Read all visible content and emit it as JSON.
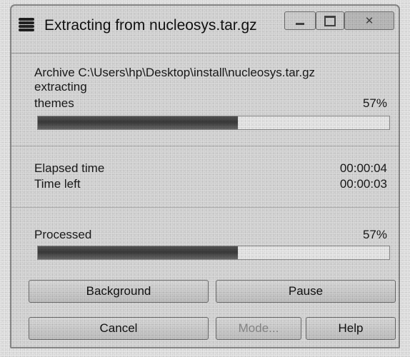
{
  "window": {
    "title": "Extracting from nucleosys.tar.gz",
    "controls": [
      "minimize",
      "maximize",
      "close"
    ]
  },
  "archive": {
    "path_line": "Archive C:\\Users\\hp\\Desktop\\install\\nucleosys.tar.gz",
    "status": "extracting",
    "current_item": "themes",
    "current_percent_label": "57%",
    "current_progress": 0.57
  },
  "timing": {
    "elapsed_label": "Elapsed time",
    "elapsed_value": "00:00:04",
    "left_label": "Time left",
    "left_value": "00:00:03"
  },
  "total": {
    "label": "Processed",
    "percent_label": "57%",
    "progress": 0.57
  },
  "buttons": {
    "background": "Background",
    "pause": "Pause",
    "cancel": "Cancel",
    "mode": "Mode...",
    "help": "Help"
  }
}
